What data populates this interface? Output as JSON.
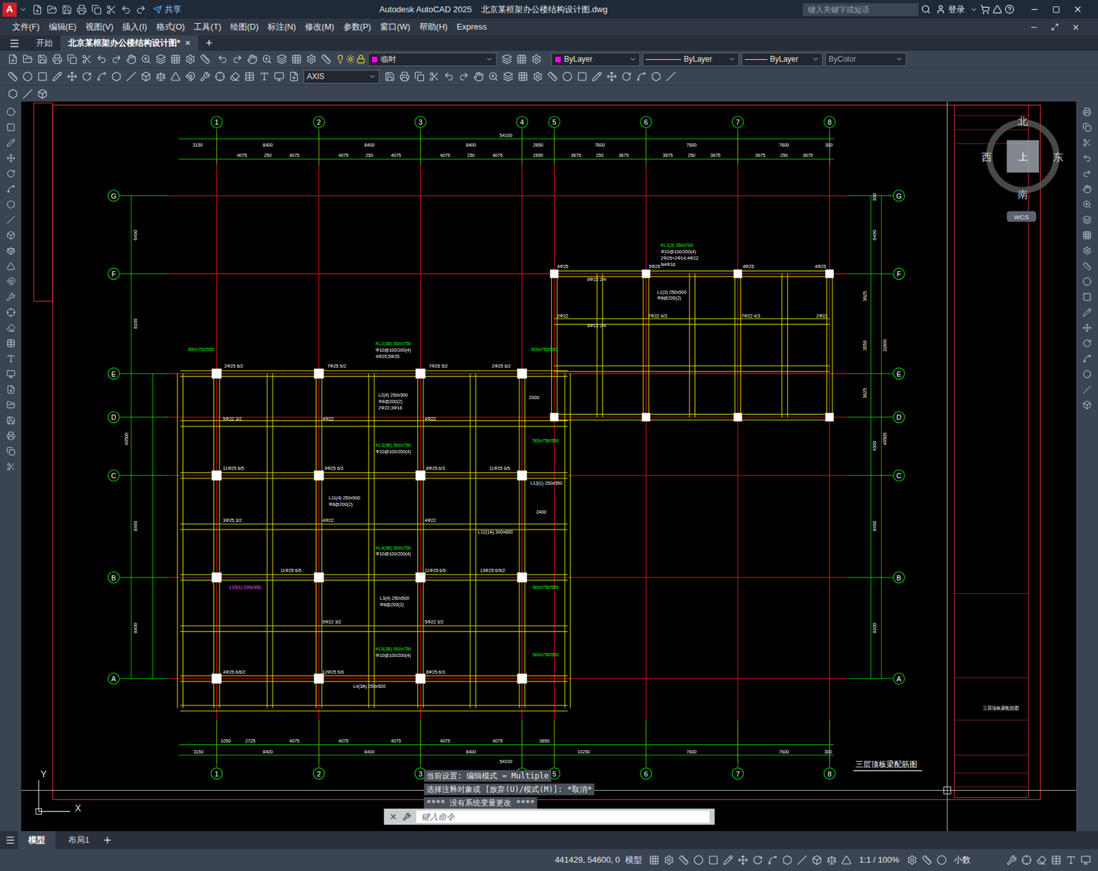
{
  "window": {
    "logo": "A",
    "app": "Autodesk AutoCAD 2025",
    "file": "北京某框架办公楼结构设计图.dwg",
    "share": "共享",
    "search_placeholder": "键入关键字或短语",
    "login": "登录"
  },
  "menu": [
    "文件(F)",
    "编辑(E)",
    "视图(V)",
    "插入(I)",
    "格式(O)",
    "工具(T)",
    "绘图(D)",
    "标注(N)",
    "修改(M)",
    "参数(P)",
    "窗口(W)",
    "帮助(H)",
    "Express"
  ],
  "doc_tabs": [
    {
      "label": "开始",
      "selected": false
    },
    {
      "label": "北京某框架办公楼结构设计图*",
      "selected": true
    }
  ],
  "tab_close": "×",
  "new_tab": "+",
  "properties": {
    "layer": "临时",
    "layer_color": "#ff00ff",
    "color": "ByLayer",
    "color_swatch": "#ff00ff",
    "linetype": "ByLayer",
    "lineweight": "ByLayer",
    "plotstyle": "ByColor"
  },
  "dim_style": "AXIS",
  "drawing": {
    "axes": {
      "columns": [
        "1",
        "2",
        "3",
        "4",
        "5",
        "6",
        "7",
        "8"
      ],
      "rows": [
        "G",
        "F",
        "E",
        "D",
        "C",
        "B",
        "A"
      ]
    },
    "total": "54100",
    "dims_top": [
      "3150",
      "8400",
      "8400",
      "8400",
      "2650",
      "7600",
      "7600",
      "7600",
      "300"
    ],
    "dims_top_detail": [
      "4075",
      "250",
      "4075",
      "4075",
      "250",
      "4075",
      "4075",
      "250",
      "4075",
      "2650",
      "3675",
      "250",
      "3675",
      "3675",
      "250",
      "3675",
      "3675",
      "250",
      "3675"
    ],
    "dims_bottom": [
      "3150",
      "8400",
      "8400",
      "8400",
      "10250",
      "7600",
      "7600",
      "300"
    ],
    "dims_bottom_detail": [
      "1050",
      "2725",
      "4075",
      "4075",
      "4075",
      "4075",
      "4075",
      "3650"
    ],
    "dims_left": [
      "6400",
      "8100",
      "40500",
      "8400",
      "8400"
    ],
    "dims_right": [
      "300",
      "6400",
      "3625",
      "3550",
      "3625",
      "11800",
      "4300",
      "40500",
      "8400",
      "8400"
    ],
    "labels": [
      {
        "text": "KL1(3) 350x700",
        "color": "#00ff00"
      },
      {
        "text": "Φ10@100/200(4)",
        "color": "#ffffff"
      },
      {
        "text": "2Φ25+2Φ14;4Φ22",
        "color": "#ffffff"
      },
      {
        "text": "N4Φ16",
        "color": "#ffffff"
      },
      {
        "text": "KL2(3B) 500x750",
        "color": "#00ff00"
      },
      {
        "text": "Φ10@100/200(4)",
        "color": "#ffffff"
      },
      {
        "text": "4Φ25;5Φ25",
        "color": "#ffffff"
      },
      {
        "text": "L2(4) 250x500",
        "color": "#ffffff"
      },
      {
        "text": "Φ8@200(2)",
        "color": "#ffffff"
      },
      {
        "text": "2Φ22;3Φ16",
        "color": "#ffffff"
      },
      {
        "text": "KL3(3B) 500x750",
        "color": "#00ff00"
      },
      {
        "text": "Φ10@100/200(4)",
        "color": "#ffffff"
      },
      {
        "text": "L11(4) 250x500",
        "color": "#ffffff"
      },
      {
        "text": "Φ8@200(2)",
        "color": "#ffffff"
      },
      {
        "text": "KL4(3B) 500x750",
        "color": "#00ff00"
      },
      {
        "text": "Φ10@100/200(4)",
        "color": "#ffffff"
      },
      {
        "text": "L3(4) 250x500",
        "color": "#ffffff"
      },
      {
        "text": "Φ8@200(2)",
        "color": "#ffffff"
      },
      {
        "text": "KL5(3B) 500x750",
        "color": "#00ff00"
      },
      {
        "text": "Φ10@100/200(4)",
        "color": "#ffffff"
      },
      {
        "text": "L12(1A) 300x600",
        "color": "#ffffff"
      },
      {
        "text": "L13(1) 250x550",
        "color": "#ffffff"
      },
      {
        "text": "L4(3A) 250x500",
        "color": "#ffffff"
      },
      {
        "text": "L1(3) 250x500",
        "color": "#ffffff"
      },
      {
        "text": "Φ8@200(2)",
        "color": "#ffffff"
      },
      {
        "text": "500x750/550",
        "color": "#00ff00"
      },
      {
        "text": "500x750/550",
        "color": "#00ff00"
      },
      {
        "text": "500x750/550",
        "color": "#00ff00"
      },
      {
        "text": "500x750/550",
        "color": "#00ff00"
      },
      {
        "text": "L15(1) 200x350",
        "color": "#ff55ff"
      },
      {
        "text": "500x750/550",
        "color": "#00ff00"
      },
      {
        "text": "2Φ25 6/2",
        "color": "#ffffff"
      },
      {
        "text": "7Φ25 5/2",
        "color": "#ffffff"
      },
      {
        "text": "7Φ25 5/2",
        "color": "#ffffff"
      },
      {
        "text": "2Φ25 6/2",
        "color": "#ffffff"
      },
      {
        "text": "4Φ25",
        "color": "#ffffff"
      },
      {
        "text": "5Φ25",
        "color": "#ffffff"
      },
      {
        "text": "4Φ25",
        "color": "#ffffff"
      },
      {
        "text": "4Φ25",
        "color": "#ffffff"
      },
      {
        "text": "5Φ22 3/2",
        "color": "#ffffff"
      },
      {
        "text": "4Φ22",
        "color": "#ffffff"
      },
      {
        "text": "4Φ22",
        "color": "#ffffff"
      },
      {
        "text": "11Φ25 6/5",
        "color": "#ffffff"
      },
      {
        "text": "9Φ25 6/3",
        "color": "#ffffff"
      },
      {
        "text": "6Φ25 6/3",
        "color": "#ffffff"
      },
      {
        "text": "11Φ25 6/5",
        "color": "#ffffff"
      },
      {
        "text": "3Φ25 3/2",
        "color": "#ffffff"
      },
      {
        "text": "4Φ22",
        "color": "#ffffff"
      },
      {
        "text": "4Φ22",
        "color": "#ffffff"
      },
      {
        "text": "11Φ25 6/5",
        "color": "#ffffff"
      },
      {
        "text": "11Φ25 6/5",
        "color": "#ffffff"
      },
      {
        "text": "13Φ25 6/5/2",
        "color": "#ffffff"
      },
      {
        "text": "4Φ25 6/6/2",
        "color": "#ffffff"
      },
      {
        "text": "12Φ25 5/6",
        "color": "#ffffff"
      },
      {
        "text": "6Φ25 6/3",
        "color": "#ffffff"
      },
      {
        "text": "5Φ22 3/2",
        "color": "#ffffff"
      },
      {
        "text": "5Φ22 3/2",
        "color": "#ffffff"
      },
      {
        "text": "7Φ22 4/3",
        "color": "#ffffff"
      },
      {
        "text": "7Φ22 4/3",
        "color": "#ffffff"
      },
      {
        "text": "2Φ22",
        "color": "#ffffff"
      },
      {
        "text": "2Φ22",
        "color": "#ffffff"
      },
      {
        "text": "6Φ22 2/4",
        "color": "#ffffff"
      },
      {
        "text": "6Φ22 2/4",
        "color": "#ffffff"
      },
      {
        "text": "2000",
        "color": "#ffffff"
      },
      {
        "text": "2400",
        "color": "#ffffff"
      }
    ],
    "caption": "三层顶板梁配筋图"
  },
  "viewcube": {
    "north": "北",
    "south": "南",
    "east": "东",
    "west": "西",
    "top": "上",
    "ucs": "WCS"
  },
  "ucs_axes": {
    "x": "X",
    "y": "Y"
  },
  "command": {
    "history": [
      "当前设置: 编辑模式 = Multiple",
      "选择注释对象或 [放弃(U)/模式(M)]: *取消*",
      "**** 没有系统变量更改 ****"
    ],
    "placeholder": "键入命令"
  },
  "layout_tabs": [
    {
      "label": "模型",
      "selected": true
    },
    {
      "label": "布局1",
      "selected": false
    }
  ],
  "status": {
    "coords": "441429, 54600, 0",
    "space": "模型",
    "scale": "1:1 / 100%",
    "units": "小数"
  }
}
